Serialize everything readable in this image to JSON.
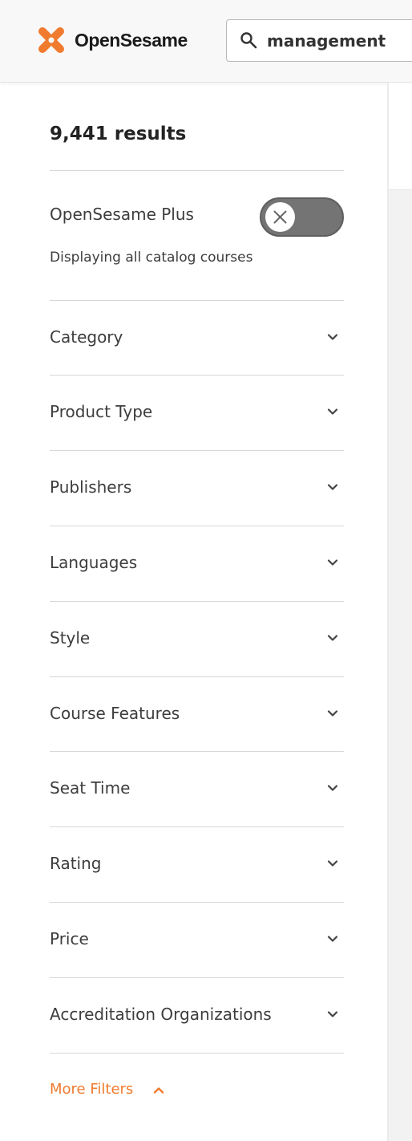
{
  "header": {
    "brand_name": "OpenSesame",
    "brand_color": "#f07b2f",
    "search": {
      "value": "management",
      "placeholder": ""
    }
  },
  "results": {
    "count_text": "9,441 results"
  },
  "plus": {
    "label": "OpenSesame Plus",
    "toggle_on": false,
    "subtitle": "Displaying all catalog courses"
  },
  "filters": [
    {
      "label": "Category",
      "icon": "chevron-down-icon"
    },
    {
      "label": "Product Type",
      "icon": "chevron-down-icon"
    },
    {
      "label": "Publishers",
      "icon": "chevron-down-icon"
    },
    {
      "label": "Languages",
      "icon": "chevron-down-icon"
    },
    {
      "label": "Style",
      "icon": "chevron-down-icon"
    },
    {
      "label": "Course Features",
      "icon": "chevron-down-icon"
    },
    {
      "label": "Seat Time",
      "icon": "chevron-down-icon"
    },
    {
      "label": "Rating",
      "icon": "chevron-down-icon"
    },
    {
      "label": "Price",
      "icon": "chevron-down-icon"
    },
    {
      "label": "Accreditation Organizations",
      "icon": "chevron-down-icon"
    }
  ],
  "more_filters": {
    "label": "More Filters",
    "icon": "chevron-up-icon"
  }
}
